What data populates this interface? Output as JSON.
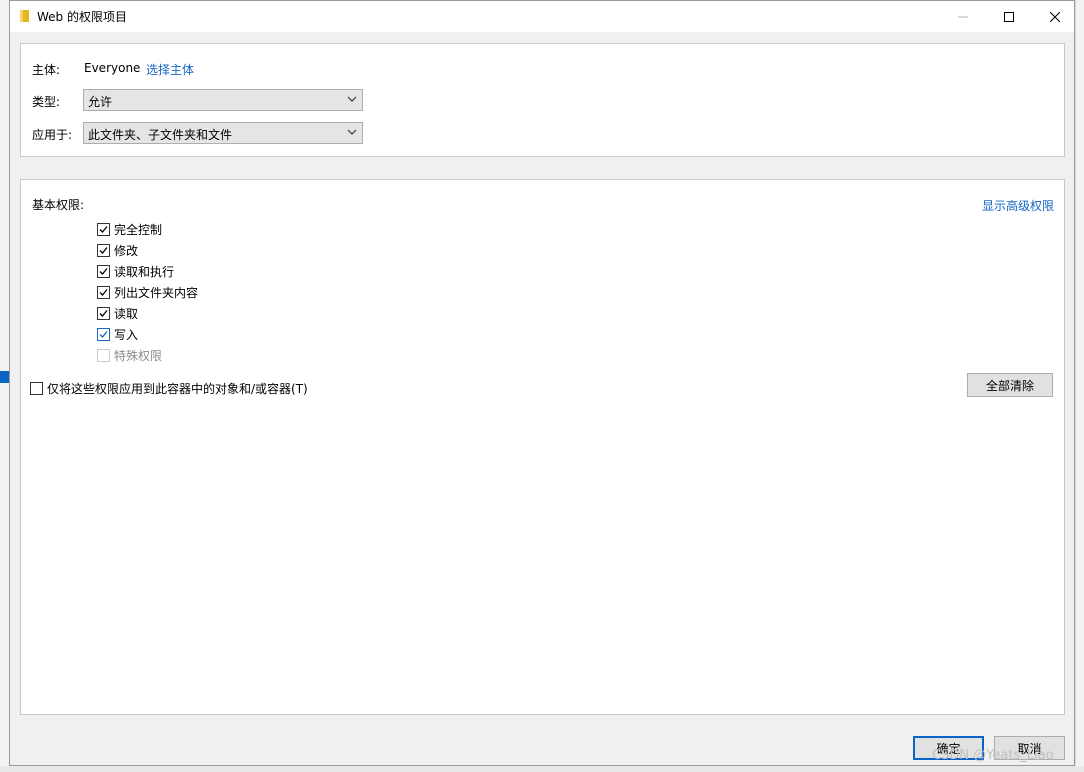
{
  "window": {
    "title": "Web 的权限项目",
    "folder_icon_color": "#e8b422"
  },
  "principal": {
    "label": "主体:",
    "value": "Everyone",
    "select_link": "选择主体"
  },
  "type": {
    "label": "类型:",
    "selected": "允许"
  },
  "applies_to": {
    "label": "应用于:",
    "selected": "此文件夹、子文件夹和文件"
  },
  "basic_permissions": {
    "heading": "基本权限:",
    "advanced_link": "显示高级权限",
    "items": [
      {
        "label": "完全控制",
        "checked": true,
        "enabled": true
      },
      {
        "label": "修改",
        "checked": true,
        "enabled": true
      },
      {
        "label": "读取和执行",
        "checked": true,
        "enabled": true
      },
      {
        "label": "列出文件夹内容",
        "checked": true,
        "enabled": true
      },
      {
        "label": "读取",
        "checked": true,
        "enabled": true
      },
      {
        "label": "写入",
        "checked": true,
        "enabled": true
      },
      {
        "label": "特殊权限",
        "checked": false,
        "enabled": false
      }
    ]
  },
  "container_only": {
    "label": "仅将这些权限应用到此容器中的对象和/或容器(T)",
    "checked": false
  },
  "buttons": {
    "clear_all": "全部清除",
    "ok": "确定",
    "cancel": "取消"
  },
  "watermark": "CSDN @Yeats_Liao",
  "colors": {
    "link": "#1766c4",
    "accent": "#0a64c8"
  }
}
